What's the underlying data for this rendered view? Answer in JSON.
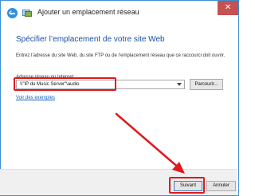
{
  "window": {
    "title": "Ajouter un emplacement réseau",
    "close_glyph": "✕"
  },
  "main": {
    "heading": "Spécifier l’emplacement de votre site Web",
    "description": "Entrez l’adresse du site Web, du site FTP ou de l’emplacement réseau que ce raccourci doit ouvrir.",
    "address_label": "Adresse réseau ou Internet :",
    "address_value": "\\\\\"IP du Music Server\"\\audio",
    "browse_label": "Parcourir...",
    "examples_link": "Voir des exemples"
  },
  "footer": {
    "next_label": "Suivant",
    "cancel_label": "Annuler"
  },
  "annotations": {
    "highlight_color": "#e0191e"
  }
}
